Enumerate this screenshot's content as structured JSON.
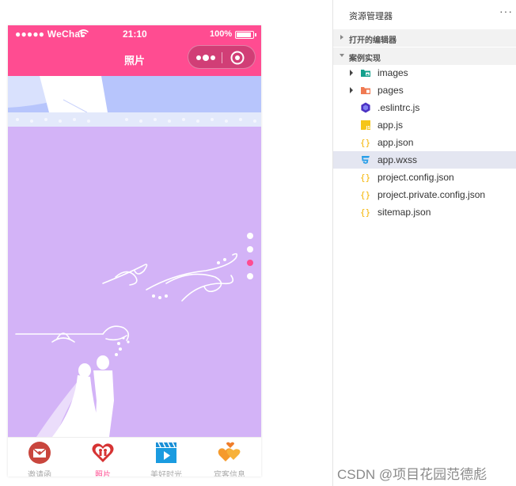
{
  "phone": {
    "status": {
      "carrier": "●●●●● WeChat",
      "time": "21:10",
      "battery": "100%"
    },
    "title": "照片",
    "slides": {
      "count": 4,
      "active_index": 2
    },
    "tabs": [
      {
        "label": "邀请函",
        "icon": "invitation-envelope-icon",
        "active": false
      },
      {
        "label": "照片",
        "icon": "couple-heart-icon",
        "active": true
      },
      {
        "label": "美好时光",
        "icon": "video-clapper-icon",
        "active": false
      },
      {
        "label": "宾客信息",
        "icon": "guest-hearts-icon",
        "active": false
      }
    ]
  },
  "explorer": {
    "title": "资源管理器",
    "more": "···",
    "sections": [
      {
        "title": "打开的编辑器",
        "expanded": false
      },
      {
        "title": "案例实现",
        "expanded": true
      }
    ],
    "files": [
      {
        "name": "images",
        "type": "folder",
        "icon": "images-folder-icon",
        "selected": false
      },
      {
        "name": "pages",
        "type": "folder",
        "icon": "pages-folder-icon",
        "selected": false
      },
      {
        "name": ".eslintrc.js",
        "type": "file",
        "icon": "eslint-icon",
        "selected": false
      },
      {
        "name": "app.js",
        "type": "file",
        "icon": "js-file-icon",
        "selected": false
      },
      {
        "name": "app.json",
        "type": "file",
        "icon": "json-file-icon",
        "selected": false
      },
      {
        "name": "app.wxss",
        "type": "file",
        "icon": "css-file-icon",
        "selected": true
      },
      {
        "name": "project.config.json",
        "type": "file",
        "icon": "json-file-icon",
        "selected": false
      },
      {
        "name": "project.private.config.json",
        "type": "file",
        "icon": "json-file-icon",
        "selected": false
      },
      {
        "name": "sitemap.json",
        "type": "file",
        "icon": "json-file-icon",
        "selected": false
      }
    ]
  },
  "watermark": "CSDN @项目花园范德彪",
  "colors": {
    "nav_pink": "#ff4c91",
    "photo_purple": "#d3b3f7",
    "photo_blue": "#b7c5fc",
    "selection": "#e4e6f1"
  }
}
